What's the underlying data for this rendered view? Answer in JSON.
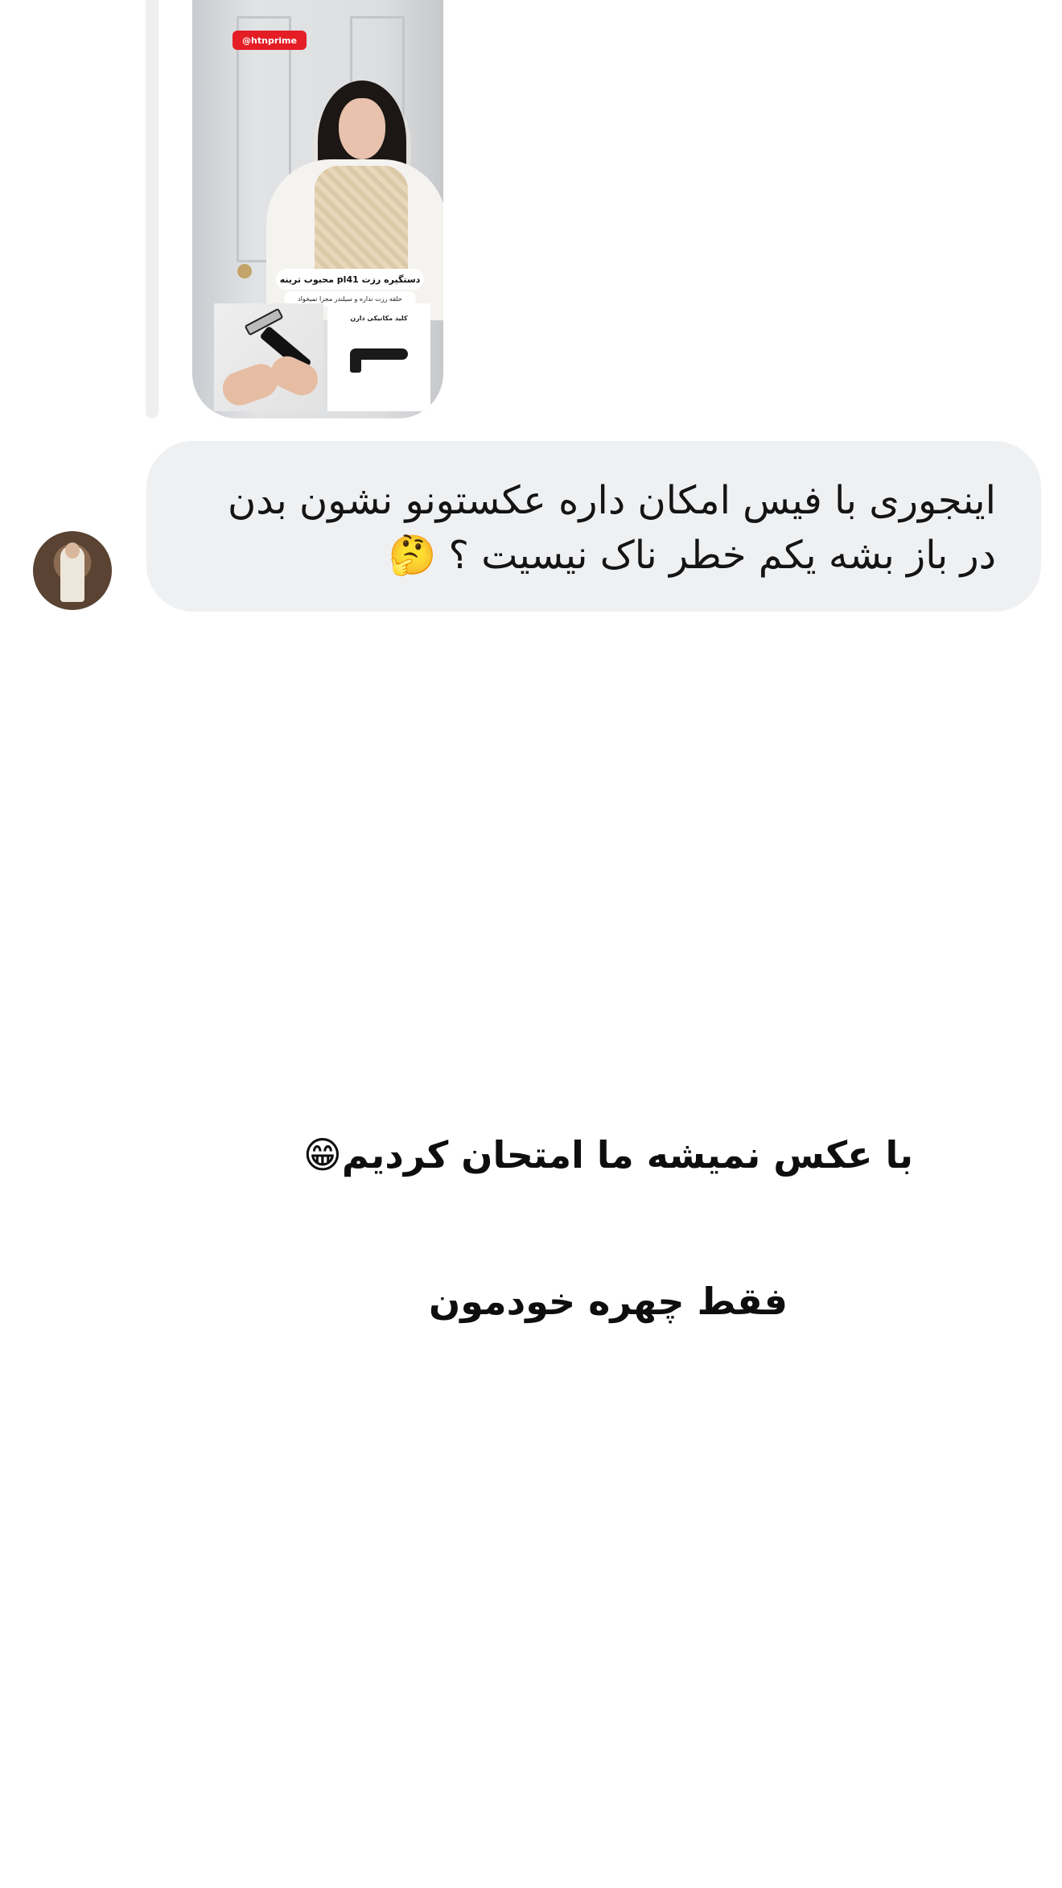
{
  "shared_post": {
    "handle": "@htnprime",
    "caption_title": "دستگیره رزت pl41 محبوب ترینه",
    "caption_subtitle": "حلقه رزت نداره و سیلندر مجزا نمیخواد",
    "product_label": "کلید مکانیکی دارن"
  },
  "message": {
    "line_1": "اینجوری با فیس امکان داره عکستونو نشون بدن",
    "line_2": "در باز بشه یکم خطر ناک نیسیت ؟ 🤔"
  },
  "notes": {
    "line_1": "با عکس نمیشه ما امتحان کردیم😁",
    "line_2": "فقط چهره خودمون"
  }
}
